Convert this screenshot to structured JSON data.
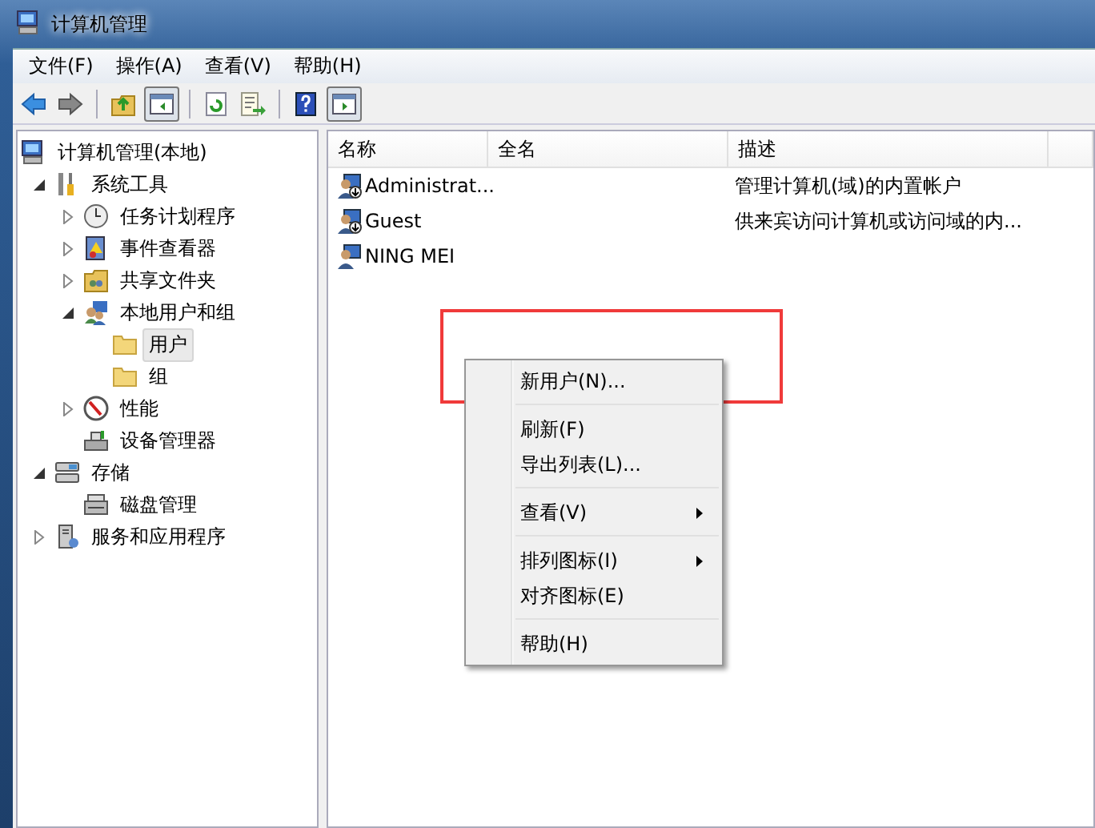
{
  "window": {
    "title": "计算机管理"
  },
  "menu_bar": [
    "文件(F)",
    "操作(A)",
    "查看(V)",
    "帮助(H)"
  ],
  "tree": [
    {
      "label": "计算机管理(本地)",
      "selected": false,
      "children": [
        {
          "label": "系统工具",
          "expanded": true,
          "selected": false,
          "children": [
            {
              "label": "任务计划程序",
              "expanded": false,
              "selected": false
            },
            {
              "label": "事件查看器",
              "expanded": false,
              "selected": false
            },
            {
              "label": "共享文件夹",
              "expanded": false,
              "selected": false
            },
            {
              "label": "本地用户和组",
              "expanded": true,
              "selected": false,
              "children": [
                {
                  "label": "用户",
                  "selected": true
                },
                {
                  "label": "组",
                  "selected": false
                }
              ]
            },
            {
              "label": "性能",
              "expanded": false,
              "selected": false
            },
            {
              "label": "设备管理器",
              "selected": false
            }
          ]
        },
        {
          "label": "存储",
          "expanded": true,
          "selected": false,
          "children": [
            {
              "label": "磁盘管理",
              "selected": false
            }
          ]
        },
        {
          "label": "服务和应用程序",
          "expanded": false,
          "selected": false
        }
      ]
    }
  ],
  "list": {
    "columns": [
      "名称",
      "全名",
      "描述"
    ],
    "rows": [
      {
        "name": "Administrat...",
        "full_name": "",
        "description": "管理计算机(域)的内置帐户",
        "disabled": true
      },
      {
        "name": "Guest",
        "full_name": "",
        "description": "供来宾访问计算机或访问域的内...",
        "disabled": true
      },
      {
        "name": "NING MEI",
        "full_name": "",
        "description": "",
        "disabled": false
      }
    ]
  },
  "context_menu": [
    {
      "kind": "item",
      "label": "新用户(N)...",
      "submenu": false
    },
    {
      "kind": "separator"
    },
    {
      "kind": "item",
      "label": "刷新(F)",
      "submenu": false
    },
    {
      "kind": "item",
      "label": "导出列表(L)...",
      "submenu": false
    },
    {
      "kind": "separator"
    },
    {
      "kind": "item",
      "label": "查看(V)",
      "submenu": true
    },
    {
      "kind": "separator"
    },
    {
      "kind": "item",
      "label": "排列图标(I)",
      "submenu": true
    },
    {
      "kind": "item",
      "label": "对齐图标(E)",
      "submenu": false
    },
    {
      "kind": "separator"
    },
    {
      "kind": "item",
      "label": "帮助(H)",
      "submenu": false
    }
  ]
}
